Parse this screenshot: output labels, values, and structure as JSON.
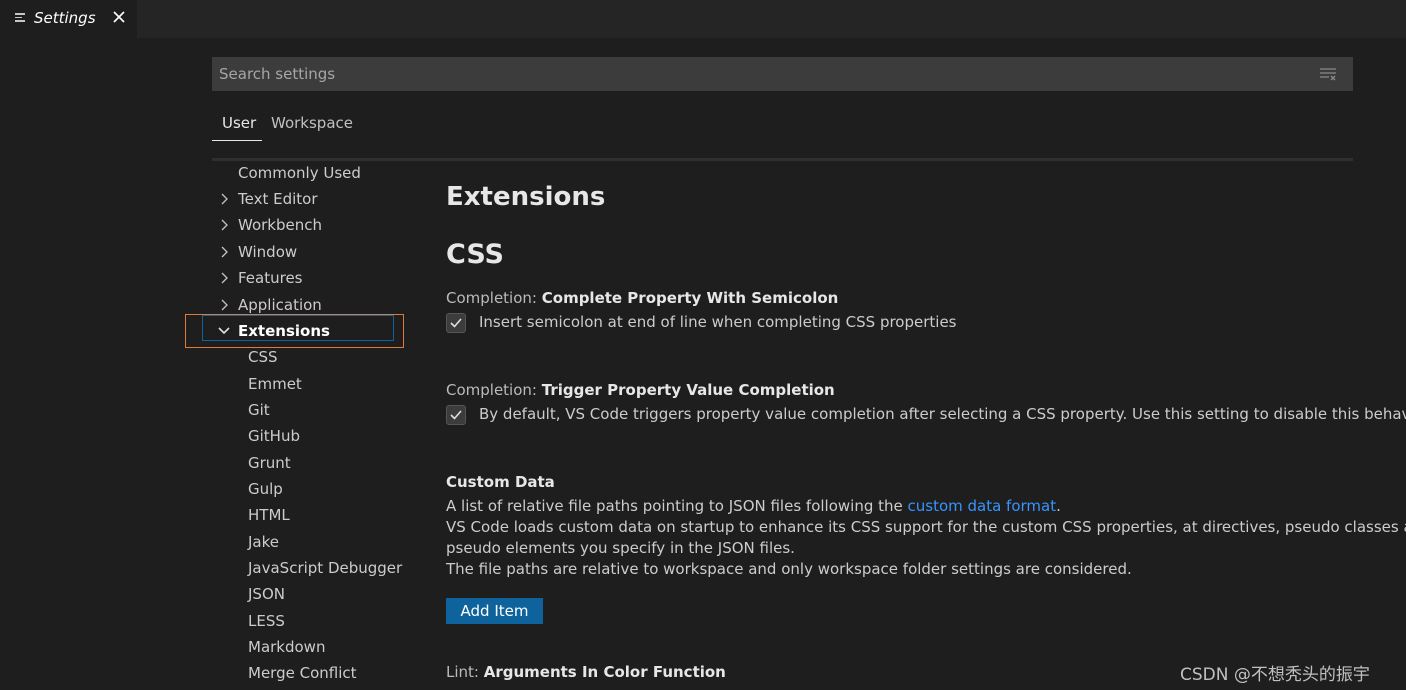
{
  "editor_tab": {
    "title": "Settings",
    "icon": "settings-editor-icon",
    "close_icon": "close-icon"
  },
  "search": {
    "placeholder": "Search settings",
    "value": "",
    "clear_icon": "clear-filter-icon"
  },
  "scope_tabs": [
    {
      "label": "User",
      "active": true
    },
    {
      "label": "Workspace",
      "active": false
    }
  ],
  "toc": {
    "items": [
      {
        "label": "Commonly Used",
        "expandable": false
      },
      {
        "label": "Text Editor",
        "expandable": true
      },
      {
        "label": "Workbench",
        "expandable": true
      },
      {
        "label": "Window",
        "expandable": true
      },
      {
        "label": "Features",
        "expandable": true
      },
      {
        "label": "Application",
        "expandable": true
      },
      {
        "label": "Extensions",
        "expandable": true,
        "expanded": true,
        "selected": true
      }
    ],
    "children": [
      "CSS",
      "Emmet",
      "Git",
      "GitHub",
      "Grunt",
      "Gulp",
      "HTML",
      "Jake",
      "JavaScript Debugger",
      "JSON",
      "LESS",
      "Markdown",
      "Merge Conflict"
    ]
  },
  "content": {
    "heading": "Extensions",
    "subheading": "CSS",
    "settings": [
      {
        "category": "Completion: ",
        "name": "Complete Property With Semicolon",
        "checked": true,
        "description": "Insert semicolon at end of line when completing CSS properties"
      },
      {
        "category": "Completion: ",
        "name": "Trigger Property Value Completion",
        "checked": true,
        "description": "By default, VS Code triggers property value completion after selecting a CSS property. Use this setting to disable this behavior."
      }
    ],
    "custom_data": {
      "title": "Custom Data",
      "line1_prefix": "A list of relative file paths pointing to JSON files following the ",
      "line1_link": "custom data format",
      "line1_suffix": ".",
      "line2": "VS Code loads custom data on startup to enhance its CSS support for the custom CSS properties, at directives, pseudo classes and",
      "line3": "pseudo elements you specify in the JSON files.",
      "line4": "The file paths are relative to workspace and only workspace folder settings are considered.",
      "button": "Add Item"
    },
    "lint": {
      "category": "Lint: ",
      "name": "Arguments In Color Function"
    }
  },
  "watermark": "CSDN @不想秃头的振宇",
  "colors": {
    "background": "#1e1e1e",
    "button": "#0e639c",
    "link": "#3794ff",
    "highlight_box": "#e0793a",
    "focus_border": "#0e639c"
  }
}
